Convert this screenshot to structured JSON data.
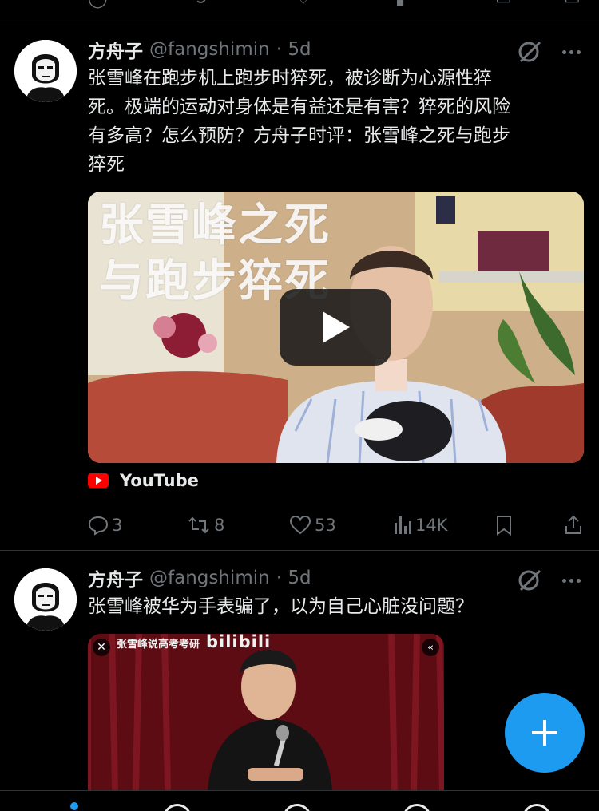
{
  "colors": {
    "background": "#000000",
    "text": "#e7e9ea",
    "muted": "#71767b",
    "accent": "#1d9bf0",
    "divider": "#2f3336",
    "youtube_red": "#ff0000"
  },
  "tweets": [
    {
      "author_name": "方舟子",
      "author_handle": "@fangshimin",
      "time": "· 5d",
      "text_lines": [
        "张雪峰在跑步机上跑步时猝死，被诊断为心源性猝",
        "死。极端的运动对身体是有益还是有害？猝死的风险",
        "有多高？怎么预防？方舟子时评：张雪峰之死与跑步",
        "猝死"
      ],
      "media": {
        "overlay_line1": "张雪峰之死",
        "overlay_line2": "与跑步猝死"
      },
      "source_label": "YouTube",
      "stats": {
        "replies": "3",
        "reposts": "8",
        "likes": "53",
        "views": "14K"
      }
    },
    {
      "author_name": "方舟子",
      "author_handle": "@fangshimin",
      "time": "· 5d",
      "text_lines": [
        "张雪峰被华为手表骗了，以为自己心脏没问题？"
      ],
      "media": {
        "caption": "张雪峰说高考考研",
        "brand": "bilibili"
      }
    }
  ],
  "icons": {
    "grok": "grok-icon",
    "more": "more-dots-icon",
    "reply": "reply-icon",
    "repost": "repost-icon",
    "like": "heart-icon",
    "views": "views-icon",
    "bookmark": "bookmark-icon",
    "share": "share-icon",
    "compose": "plus-icon",
    "play": "play-icon"
  }
}
